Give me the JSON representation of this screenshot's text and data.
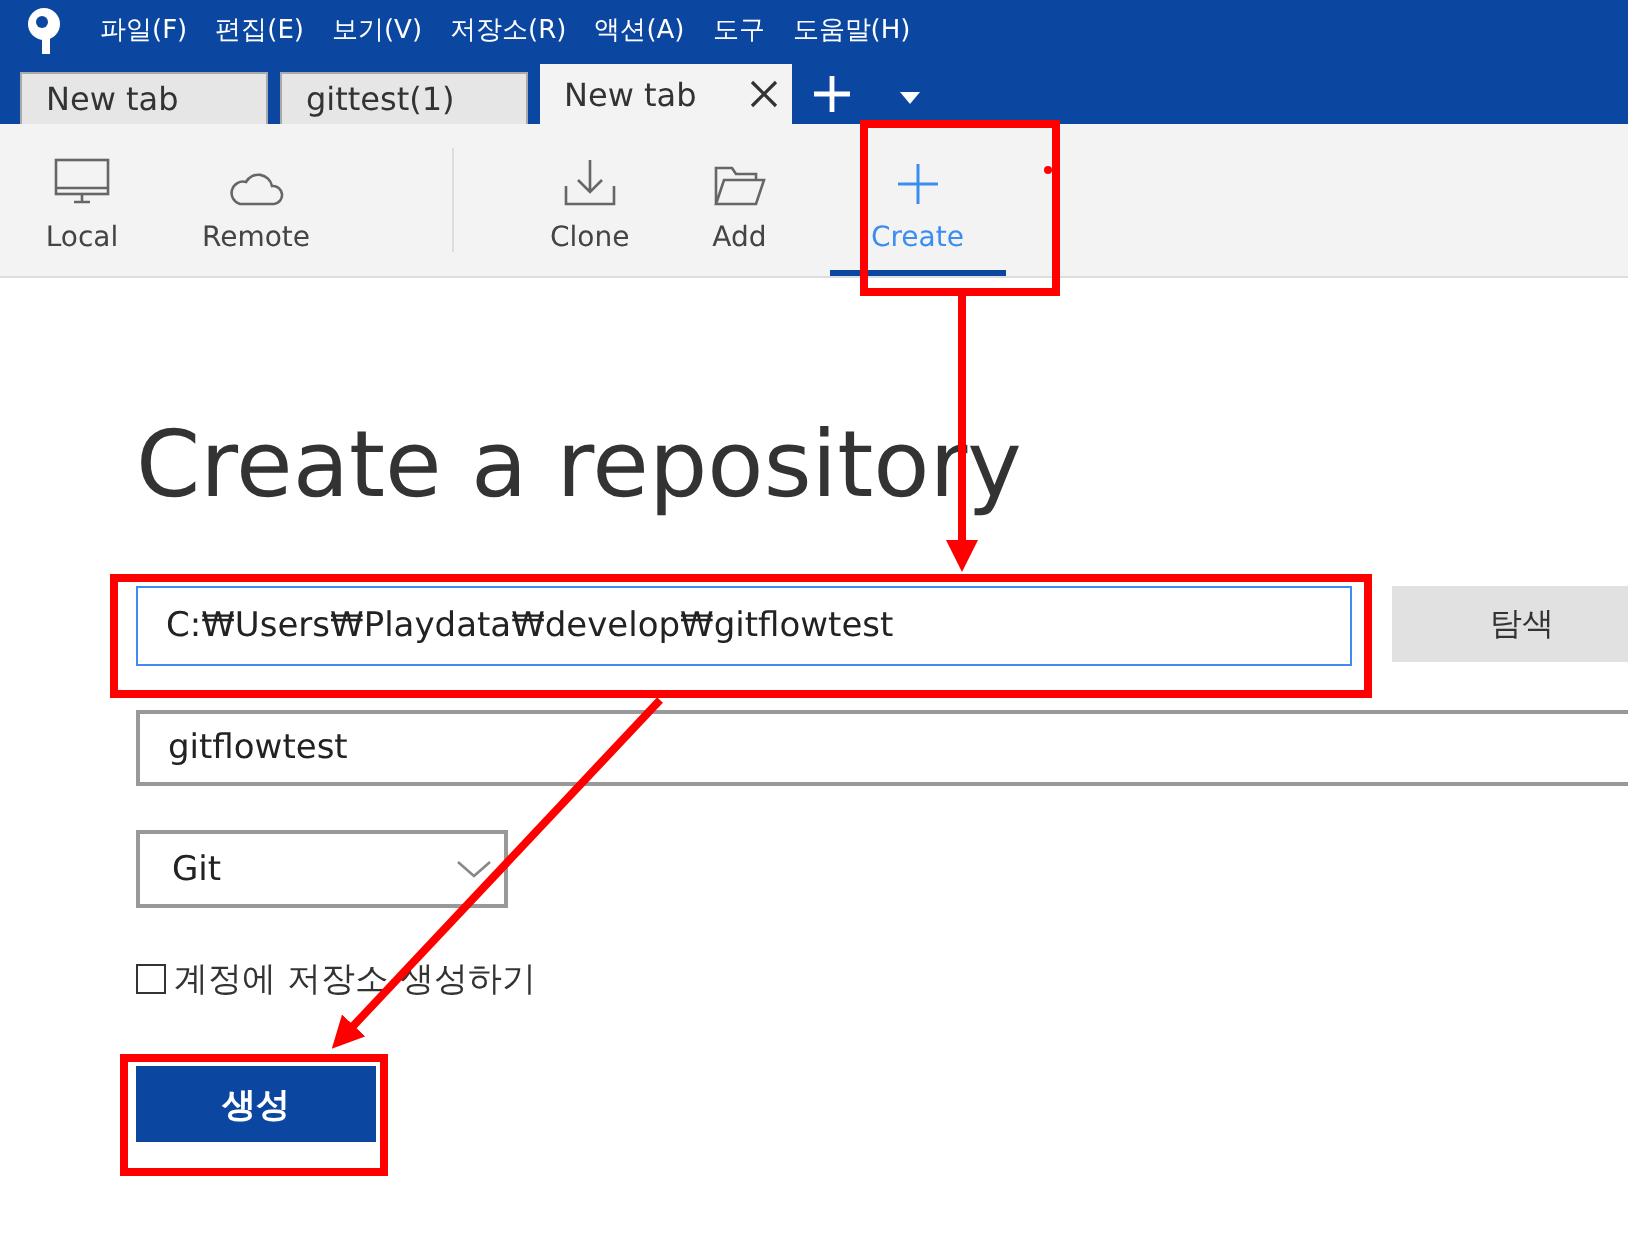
{
  "menu": [
    "파일(F)",
    "편집(E)",
    "보기(V)",
    "저장소(R)",
    "액션(A)",
    "도구",
    "도움말(H)"
  ],
  "tabs": [
    {
      "label": "New tab",
      "selected": false,
      "closable": false
    },
    {
      "label": "gittest(1)",
      "selected": false,
      "closable": false
    },
    {
      "label": "New tab",
      "selected": true,
      "closable": true
    }
  ],
  "toolbar": [
    {
      "label": "Local",
      "kind": "monitor",
      "selected": false
    },
    {
      "label": "Remote",
      "kind": "cloud",
      "selected": false
    },
    {
      "label": "Clone",
      "kind": "download",
      "selected": false
    },
    {
      "label": "Add",
      "kind": "folder",
      "selected": false
    },
    {
      "label": "Create",
      "kind": "plus",
      "selected": true
    }
  ],
  "heading": "Create a repository",
  "path_field": {
    "value": "C:₩Users₩Playdata₩develop₩gitflowtest"
  },
  "browse_button": "탐색",
  "name_field": {
    "value": "gitflowtest"
  },
  "vcs_select": {
    "value": "Git"
  },
  "account_checkbox": {
    "label": "계정에 저장소 생성하기",
    "checked": false
  },
  "create_button": "생성"
}
